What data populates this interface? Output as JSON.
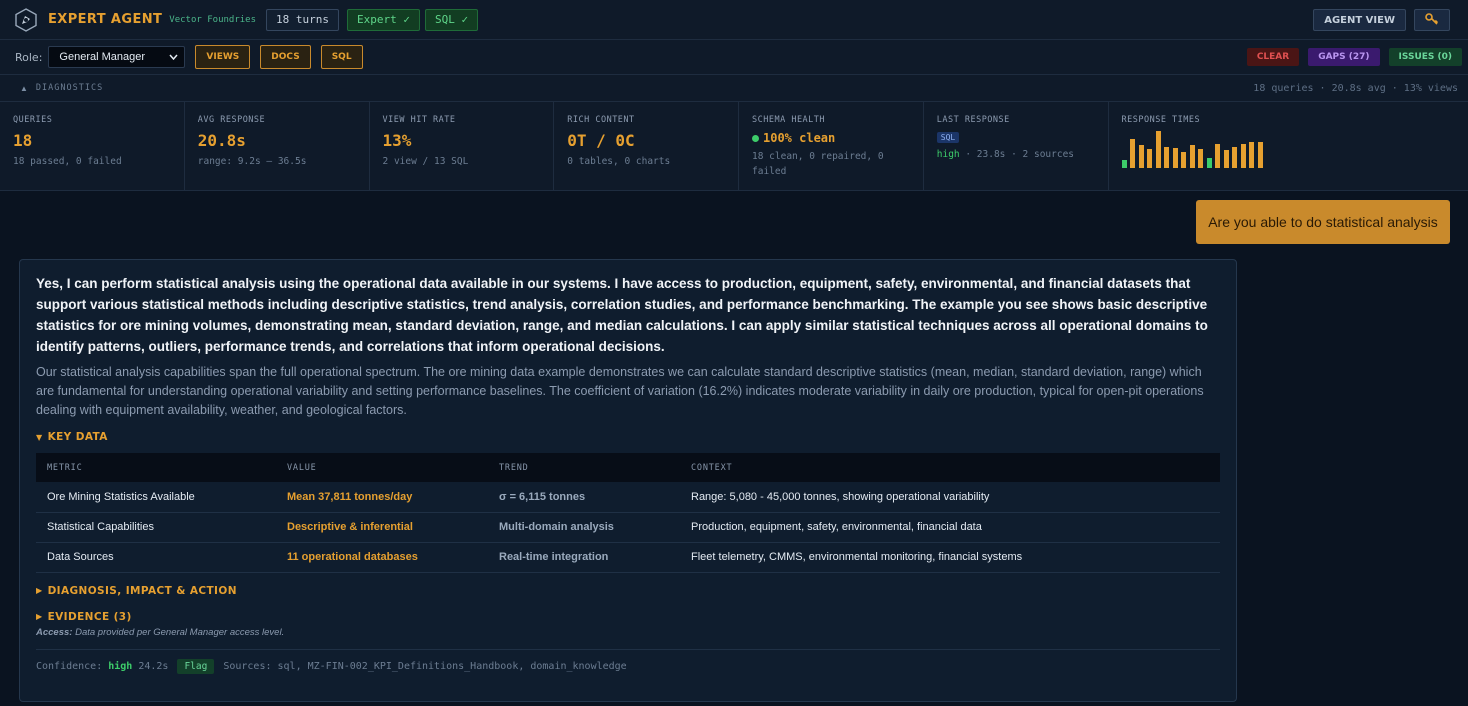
{
  "header": {
    "brand": "EXPERT AGENT",
    "brand_sub": "Vector Foundries",
    "turns": "18 turns",
    "badges": [
      "Expert ✓",
      "SQL ✓"
    ],
    "agent_view": "AGENT VIEW",
    "key_icon": "🔑"
  },
  "rolebar": {
    "role_label": "Role:",
    "role_value": "General Manager",
    "buttons": [
      "VIEWS",
      "DOCS",
      "SQL"
    ],
    "clear": "CLEAR",
    "gaps": "GAPS (27)",
    "issues": "ISSUES (0)"
  },
  "diagnostics": {
    "toggle": "▲",
    "label": "DIAGNOSTICS",
    "summary": "18 queries · 20.8s avg · 13% views",
    "metrics": {
      "queries": {
        "label": "QUERIES",
        "value": "18",
        "sub": "18 passed, 0 failed"
      },
      "avg_response": {
        "label": "AVG RESPONSE",
        "value": "20.8s",
        "sub": "range: 9.2s – 36.5s"
      },
      "view_hit": {
        "label": "VIEW HIT RATE",
        "value": "13%",
        "sub": "2 view / 13 SQL"
      },
      "rich": {
        "label": "RICH CONTENT",
        "value": "0T / 0C",
        "sub": "0 tables, 0 charts"
      },
      "schema": {
        "label": "SCHEMA HEALTH",
        "value": "100% clean",
        "sub": "18 clean, 0 repaired, 0 failed"
      },
      "last": {
        "label": "LAST RESPONSE",
        "badge": "SQL",
        "confidence": "high",
        "sub": " · 23.8s · 2 sources"
      },
      "response_times": {
        "label": "RESPONSE TIMES"
      }
    },
    "spark_values": [
      0.22,
      0.78,
      0.62,
      0.5,
      1.0,
      0.58,
      0.55,
      0.42,
      0.62,
      0.52,
      0.28,
      0.65,
      0.48,
      0.58,
      0.66,
      0.7,
      0.7
    ]
  },
  "user_message": "Are you able to do statistical analysis",
  "answer": {
    "lead": "Yes, I can perform statistical analysis using the operational data available in our systems. I have access to production, equipment, safety, environmental, and financial datasets that support various statistical methods including descriptive statistics, trend analysis, correlation studies, and performance benchmarking. The example you see shows basic descriptive statistics for ore mining volumes, demonstrating mean, standard deviation, range, and median calculations. I can apply similar statistical techniques across all operational domains to identify patterns, outliers, performance trends, and correlations that inform operational decisions.",
    "body": "Our statistical analysis capabilities span the full operational spectrum. The ore mining data example demonstrates we can calculate standard descriptive statistics (mean, median, standard deviation, range) which are fundamental for understanding operational variability and setting performance baselines. The coefficient of variation (16.2%) indicates moderate variability in daily ore production, typical for open-pit operations dealing with equipment availability, weather, and geological factors.",
    "key_data_label": "KEY DATA",
    "table": {
      "headers": [
        "METRIC",
        "VALUE",
        "TREND",
        "CONTEXT"
      ],
      "rows": [
        [
          "Ore Mining Statistics Available",
          "Mean 37,811 tonnes/day",
          "σ = 6,115 tonnes",
          "Range: 5,080 - 45,000 tonnes, showing operational variability"
        ],
        [
          "Statistical Capabilities",
          "Descriptive & inferential",
          "Multi-domain analysis",
          "Production, equipment, safety, environmental, financial data"
        ],
        [
          "Data Sources",
          "11 operational databases",
          "Real-time integration",
          "Fleet telemetry, CMMS, environmental monitoring, financial systems"
        ]
      ]
    },
    "diagnosis_label": "DIAGNOSIS, IMPACT & ACTION",
    "evidence_label": "EVIDENCE (3)",
    "access_label": "Access:",
    "access_text": " Data provided per General Manager access level.",
    "footer": {
      "confidence_label": "Confidence:",
      "confidence": "high",
      "time": "24.2s",
      "flag": "Flag",
      "sources": "Sources: sql, MZ-FIN-002_KPI_Definitions_Handbook, domain_knowledge"
    }
  },
  "colors": {
    "accent": "#e6a030",
    "green": "#3dcc6a",
    "bg": "#0c1522"
  }
}
